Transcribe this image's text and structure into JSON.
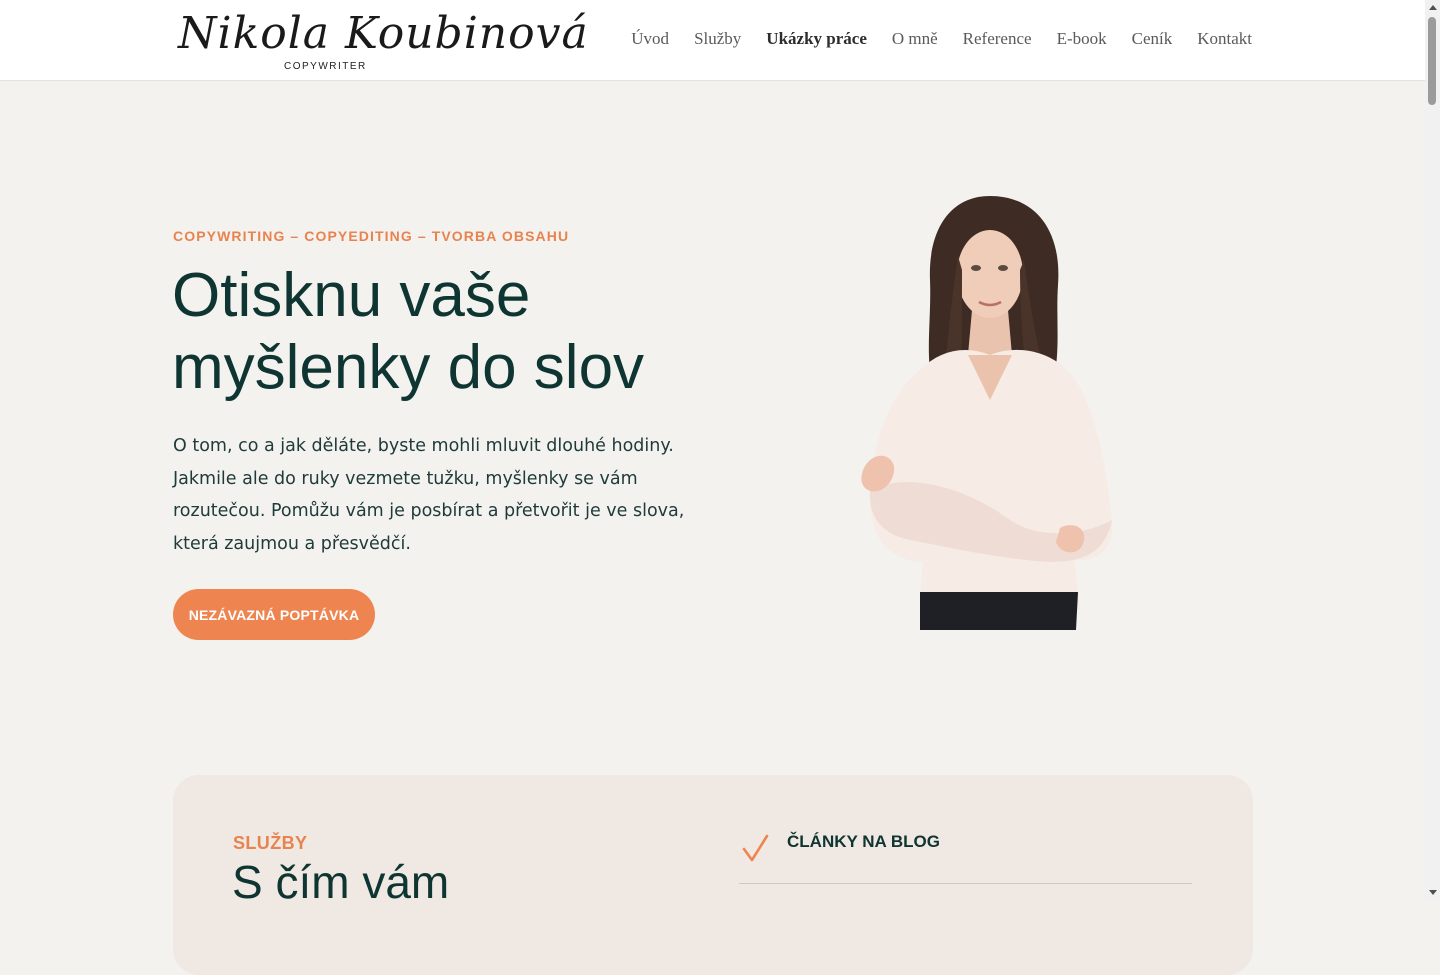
{
  "header": {
    "logo_name": "Nikola Koubinová",
    "logo_sub": "COPYWRITER",
    "nav": [
      {
        "label": "Úvod"
      },
      {
        "label": "Služby"
      },
      {
        "label": "Ukázky práce"
      },
      {
        "label": "O mně"
      },
      {
        "label": "Reference"
      },
      {
        "label": "E-book"
      },
      {
        "label": "Ceník"
      },
      {
        "label": "Kontakt"
      }
    ],
    "active_nav": "Ukázky práce"
  },
  "hero": {
    "kicker": "COPYWRITING – COPYEDITING – TVORBA OBSAHU",
    "headline": "Otisknu vaše myšlenky do slov",
    "lead": "O tom, co a jak děláte, byste mohli mluvit dlouhé hodiny. Jakmile ale do ruky vezmete tužku, myšlenky se vám rozutečou. Pomůžu vám je posbírat a přetvořit je ve slova, která zaujmou a přesvědčí.",
    "cta_label": "NEZÁVAZNÁ POPTÁVKA",
    "portrait_icon": "portrait-photo"
  },
  "services": {
    "label": "SLUŽBY",
    "heading": "S čím vám",
    "items": [
      {
        "title": "ČLÁNKY NA BLOG",
        "icon": "check-icon"
      }
    ]
  },
  "colors": {
    "accent": "#ee8551",
    "heading": "#0f3532",
    "background": "#f3f2ee",
    "card": "#f0e8e2"
  }
}
